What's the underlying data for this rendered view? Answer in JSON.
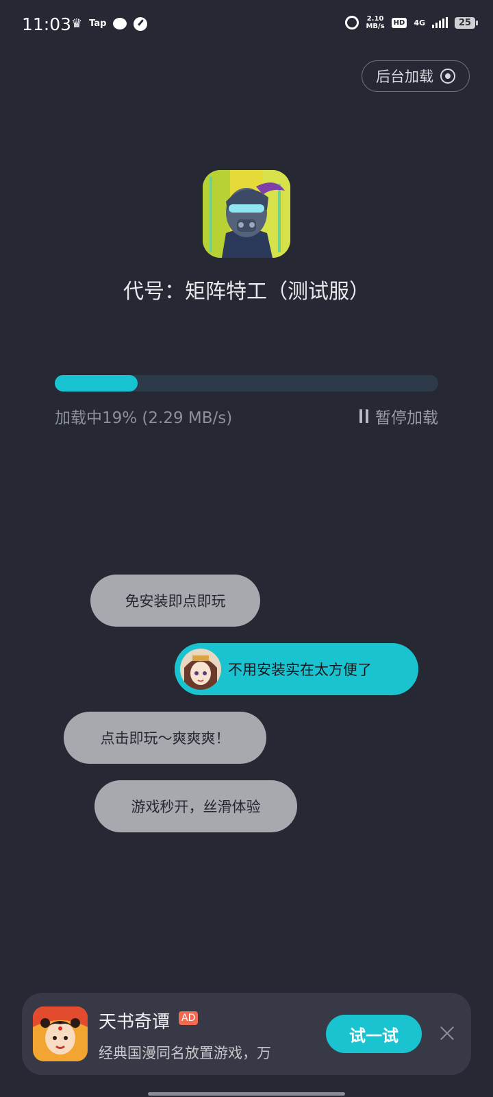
{
  "status_bar": {
    "time": "11:03",
    "tap_label": "Tap",
    "net_speed_value": "2.10",
    "net_speed_unit": "MB/s",
    "hd": "HD",
    "network": "4G",
    "battery": "25"
  },
  "background_load": {
    "label": "后台加载",
    "icon": "target-icon"
  },
  "app": {
    "title": "代号：矩阵特工（测试服）"
  },
  "progress": {
    "percent": 19,
    "text": "加载中19% (2.29 MB/s)",
    "pause_label": "暂停加载"
  },
  "chat_messages": [
    {
      "text": "免安装即点即玩"
    },
    {
      "text": "不用安装实在太方便了"
    },
    {
      "text": "点击即玩～爽爽爽！"
    },
    {
      "text": "游戏秒开，丝滑体验"
    }
  ],
  "ad": {
    "title": "天书奇谭",
    "badge": "AD",
    "description": "经典国漫同名放置游戏，万",
    "button": "试一试"
  },
  "colors": {
    "accent": "#18c3d1",
    "background": "#262833"
  }
}
